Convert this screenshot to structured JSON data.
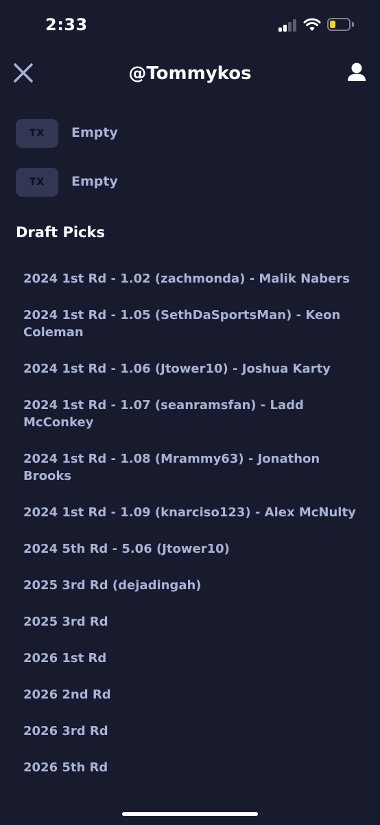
{
  "status_bar": {
    "time": "2:33",
    "battery_level": 0.3,
    "battery_color": "#f5d31c",
    "signal_bars_active": 2,
    "signal_bars_total": 4
  },
  "header": {
    "title": "@Tommykos",
    "close_icon": "close-icon",
    "user_icon": "user-icon"
  },
  "tx_rows": [
    {
      "badge": "TX",
      "label": "Empty"
    },
    {
      "badge": "TX",
      "label": "Empty"
    }
  ],
  "draft_picks": {
    "title": "Draft Picks",
    "items": [
      "2024 1st Rd - 1.02 (zachmonda) - Malik Nabers",
      "2024 1st Rd - 1.05 (SethDaSportsMan) - Keon Coleman",
      "2024 1st Rd - 1.06 (Jtower10) - Joshua Karty",
      "2024 1st Rd - 1.07 (seanramsfan) - Ladd McConkey",
      "2024 1st Rd - 1.08 (Mrammy63) - Jonathon Brooks",
      "2024 1st Rd - 1.09 (knarciso123) - Alex McNulty",
      "2024 5th Rd - 5.06 (Jtower10)",
      "2025 3rd Rd (dejadingah)",
      "2025 3rd Rd",
      "2026 1st Rd",
      "2026 2nd Rd",
      "2026 3rd Rd",
      "2026 5th Rd"
    ]
  },
  "colors": {
    "background": "#181b2e",
    "text": "#a9b3d6",
    "badge": "#323754",
    "heading": "#ffffff"
  }
}
